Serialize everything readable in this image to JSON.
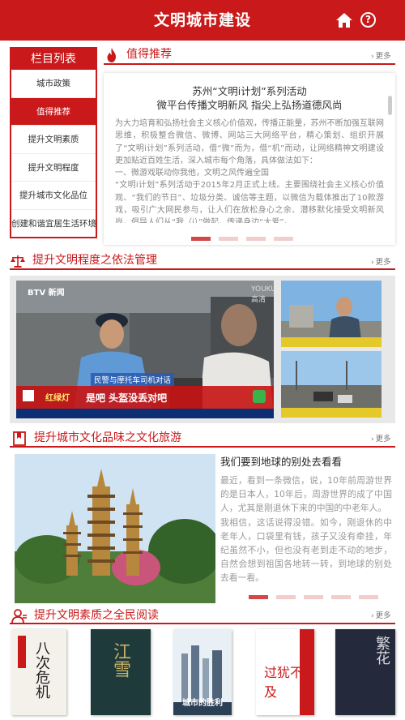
{
  "header": {
    "title": "文明城市建设",
    "home_icon": "home-icon",
    "help_icon": "help-icon",
    "help_glyph": "?"
  },
  "sidebar": {
    "title": "栏目列表",
    "items": [
      {
        "label": "城市政策"
      },
      {
        "label": "值得推荐"
      },
      {
        "label": "提升文明素质"
      },
      {
        "label": "提升文明程度"
      },
      {
        "label": "提升城市文化品位"
      },
      {
        "label": "创建和谐宜居生活环境"
      }
    ]
  },
  "recommend": {
    "heading": "值得推荐",
    "more": "更多",
    "title": "苏州“文明i计划”系列活动",
    "subtitle": "微平台传播文明新风 指尖上弘扬道德风尚",
    "body": "为大力培育和弘扬社会主义核心价值观，传播正能量，苏州不断加强互联网思维，积极整合微信、微博、网站三大网络平台，精心策划、组织开展了“文明i计划”系列活动，借“微”而为，借“机”而动，让网络精神文明建设更加贴近百姓生活，深入城市每个角落，具体做法如下：\n一、微游戏联动你我他，文明之风传遍全国\n“文明i计划”系列活动于2015年2月正式上线。主要围绕社会主义核心价值观、“我们的节日”、垃圾分类、诚信等主题，以微信为载体推出了10款游戏，吸引广大网民参与，让人们在放松身心之余、潜移默化接受文明新风尚，倡导人们从“我（i）”做起，传递身边“大爱”。"
  },
  "law": {
    "heading": "提升文明程度之依法管理",
    "more": "更多",
    "video": {
      "channel": "BTV 新闻",
      "watermark": "YOUKU 高清",
      "caption_top": "民警与摩托车司机对话",
      "brand": "红绿灯",
      "caption_main": "是吧 头盔没丢对吧"
    }
  },
  "travel": {
    "heading": "提升城市文化品味之文化旅游",
    "more": "更多",
    "title": "我们要到地球的别处去看看",
    "body": "最近，看到一条微信，说，10年前周游世界的是日本人，10年后，周游世界的成了中国人，尤其是刚退休下来的中国的中老年人。\n我相信，这话说得没错。如今，刚退休的中老年人，口袋里有钱，孩子又没有牵挂，年纪虽然不小，但也没有老到走不动的地步，自然会想到祖国各地转一转，到地球的别处去看一看。\n有人甚至把退休后的旅游生活归纳了……"
  },
  "reading": {
    "heading": "提升文明素质之全民阅读",
    "more": "更多",
    "books": [
      {
        "title": "八次危机"
      },
      {
        "title": "江雪"
      },
      {
        "title": "城市的胜利"
      },
      {
        "title": "过犹不及"
      },
      {
        "title": "繁花"
      }
    ]
  },
  "colors": {
    "brand_red": "#c9191a",
    "dot_active": "#d24747",
    "dot_inactive": "#f3cccc"
  }
}
